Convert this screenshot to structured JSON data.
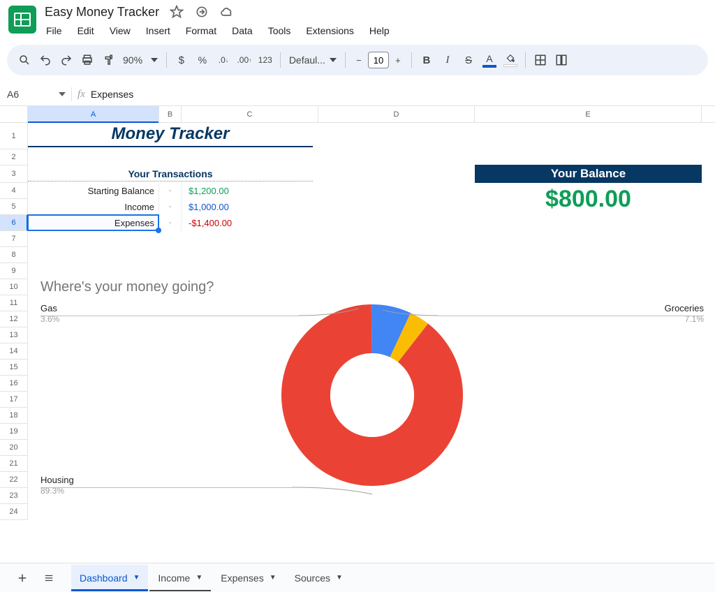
{
  "header": {
    "title": "Easy Money Tracker"
  },
  "menu": {
    "items": [
      "File",
      "Edit",
      "View",
      "Insert",
      "Format",
      "Data",
      "Tools",
      "Extensions",
      "Help"
    ]
  },
  "toolbar": {
    "zoom": "90%",
    "font_name": "Defaul...",
    "font_size": "10",
    "number_123": "123"
  },
  "namebox": {
    "ref": "A6",
    "formula": "Expenses"
  },
  "columns": [
    "A",
    "B",
    "C",
    "D",
    "E"
  ],
  "selected_column": "A",
  "row_count": 24,
  "selected_row": 6,
  "sheet": {
    "title": "Money Tracker",
    "transactions_header": "Your Transactions",
    "rows": [
      {
        "label": "Starting Balance",
        "dash": "-",
        "value": "$1,200.00",
        "tone": "green"
      },
      {
        "label": "Income",
        "dash": "-",
        "value": "$1,000.00",
        "tone": "blue"
      },
      {
        "label": "Expenses",
        "dash": "-",
        "value": "-$1,400.00",
        "tone": "red"
      }
    ],
    "balance": {
      "header": "Your Balance",
      "value": "$800.00"
    },
    "chart_title": "Where's your money going?"
  },
  "chart_data": {
    "type": "pie",
    "title": "Where's your money going?",
    "series": [
      {
        "name": "Housing",
        "value": 89.3,
        "label": "89.3%",
        "color": "#ea4335"
      },
      {
        "name": "Groceries",
        "value": 7.1,
        "label": "7.1%",
        "color": "#4285f4"
      },
      {
        "name": "Gas",
        "value": 3.6,
        "label": "3.6%",
        "color": "#fbbc04"
      }
    ],
    "donut_inner_ratio": 0.5
  },
  "tabs": {
    "items": [
      "Dashboard",
      "Income",
      "Expenses",
      "Sources"
    ],
    "active": "Dashboard"
  }
}
